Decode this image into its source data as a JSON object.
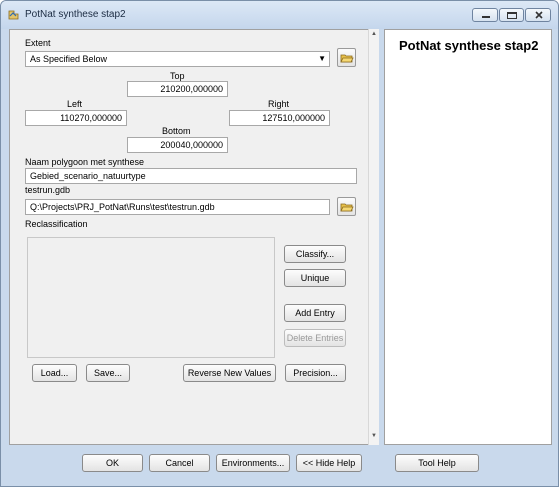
{
  "window": {
    "title": "PotNat synthese stap2"
  },
  "extent": {
    "label": "Extent",
    "selected": "As Specified Below",
    "top_label": "Top",
    "top_value": "210200,000000",
    "left_label": "Left",
    "left_value": "110270,000000",
    "right_label": "Right",
    "right_value": "127510,000000",
    "bottom_label": "Bottom",
    "bottom_value": "200040,000000"
  },
  "polygon": {
    "label": "Naam polygoon met synthese",
    "value": "Gebied_scenario_natuurtype"
  },
  "gdb": {
    "label": "testrun.gdb",
    "value": "Q:\\Projects\\PRJ_PotNat\\Runs\\test\\testrun.gdb"
  },
  "reclass": {
    "label": "Reclassification",
    "classify": "Classify...",
    "unique": "Unique",
    "add_entry": "Add Entry",
    "delete_entries": "Delete Entries",
    "load": "Load...",
    "save": "Save...",
    "reverse": "Reverse New Values",
    "precision": "Precision..."
  },
  "help": {
    "title": "PotNat synthese stap2"
  },
  "footer": {
    "ok": "OK",
    "cancel": "Cancel",
    "environments": "Environments...",
    "hide_help": "<< Hide Help",
    "tool_help": "Tool Help"
  },
  "icons": {
    "app": "script-tool-icon",
    "minimize": "minimize-icon",
    "maximize": "maximize-icon",
    "close": "close-icon",
    "folder": "open-folder-icon",
    "dropdown": "chevron-down-icon"
  },
  "colors": {
    "frame": "#c9d9ec",
    "panel": "#f0f0f0",
    "close_red": "#c44a3c"
  }
}
